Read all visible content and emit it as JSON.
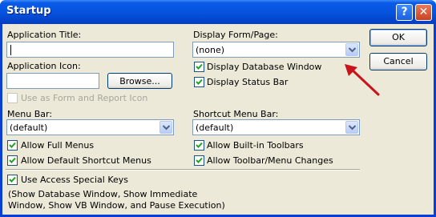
{
  "window": {
    "title": "Startup"
  },
  "titlebar": {
    "help_glyph": "?",
    "close_glyph": "✕"
  },
  "left": {
    "app_title_label": "Application Title:",
    "app_title_value": "",
    "app_icon_label": "Application Icon:",
    "app_icon_value": "",
    "browse_label": "Browse...",
    "use_as_form_icon_label": "Use as Form and Report Icon",
    "use_as_form_icon_checked": false,
    "menu_bar_label": "Menu Bar:",
    "menu_bar_value": "(default)",
    "allow_full_menus_label": "Allow Full Menus",
    "allow_full_menus_checked": true,
    "allow_default_shortcut_label": "Allow Default Shortcut Menus",
    "allow_default_shortcut_checked": true
  },
  "right": {
    "display_form_label": "Display Form/Page:",
    "display_form_value": "(none)",
    "display_db_window_label": "Display Database Window",
    "display_db_window_checked": true,
    "display_status_bar_label": "Display Status Bar",
    "display_status_bar_checked": true,
    "shortcut_menu_bar_label": "Shortcut Menu Bar:",
    "shortcut_menu_bar_value": "(default)",
    "allow_builtin_toolbars_label": "Allow Built-in Toolbars",
    "allow_builtin_toolbars_checked": true,
    "allow_toolbar_changes_label": "Allow Toolbar/Menu Changes",
    "allow_toolbar_changes_checked": true
  },
  "bottom": {
    "use_special_keys_label": "Use Access Special Keys",
    "use_special_keys_checked": true,
    "note_text": "(Show Database Window, Show Immediate Window, Show VB Window, and Pause Execution)"
  },
  "buttons": {
    "ok_label": "OK",
    "cancel_label": "Cancel"
  },
  "colors": {
    "title_bar": "#0654e0",
    "dialog_face": "#ece9d8",
    "arrow": "#c8141c"
  },
  "icons": [
    "help-icon",
    "close-icon",
    "dropdown-arrow-icon",
    "checkmark-icon",
    "annotation-arrow"
  ]
}
